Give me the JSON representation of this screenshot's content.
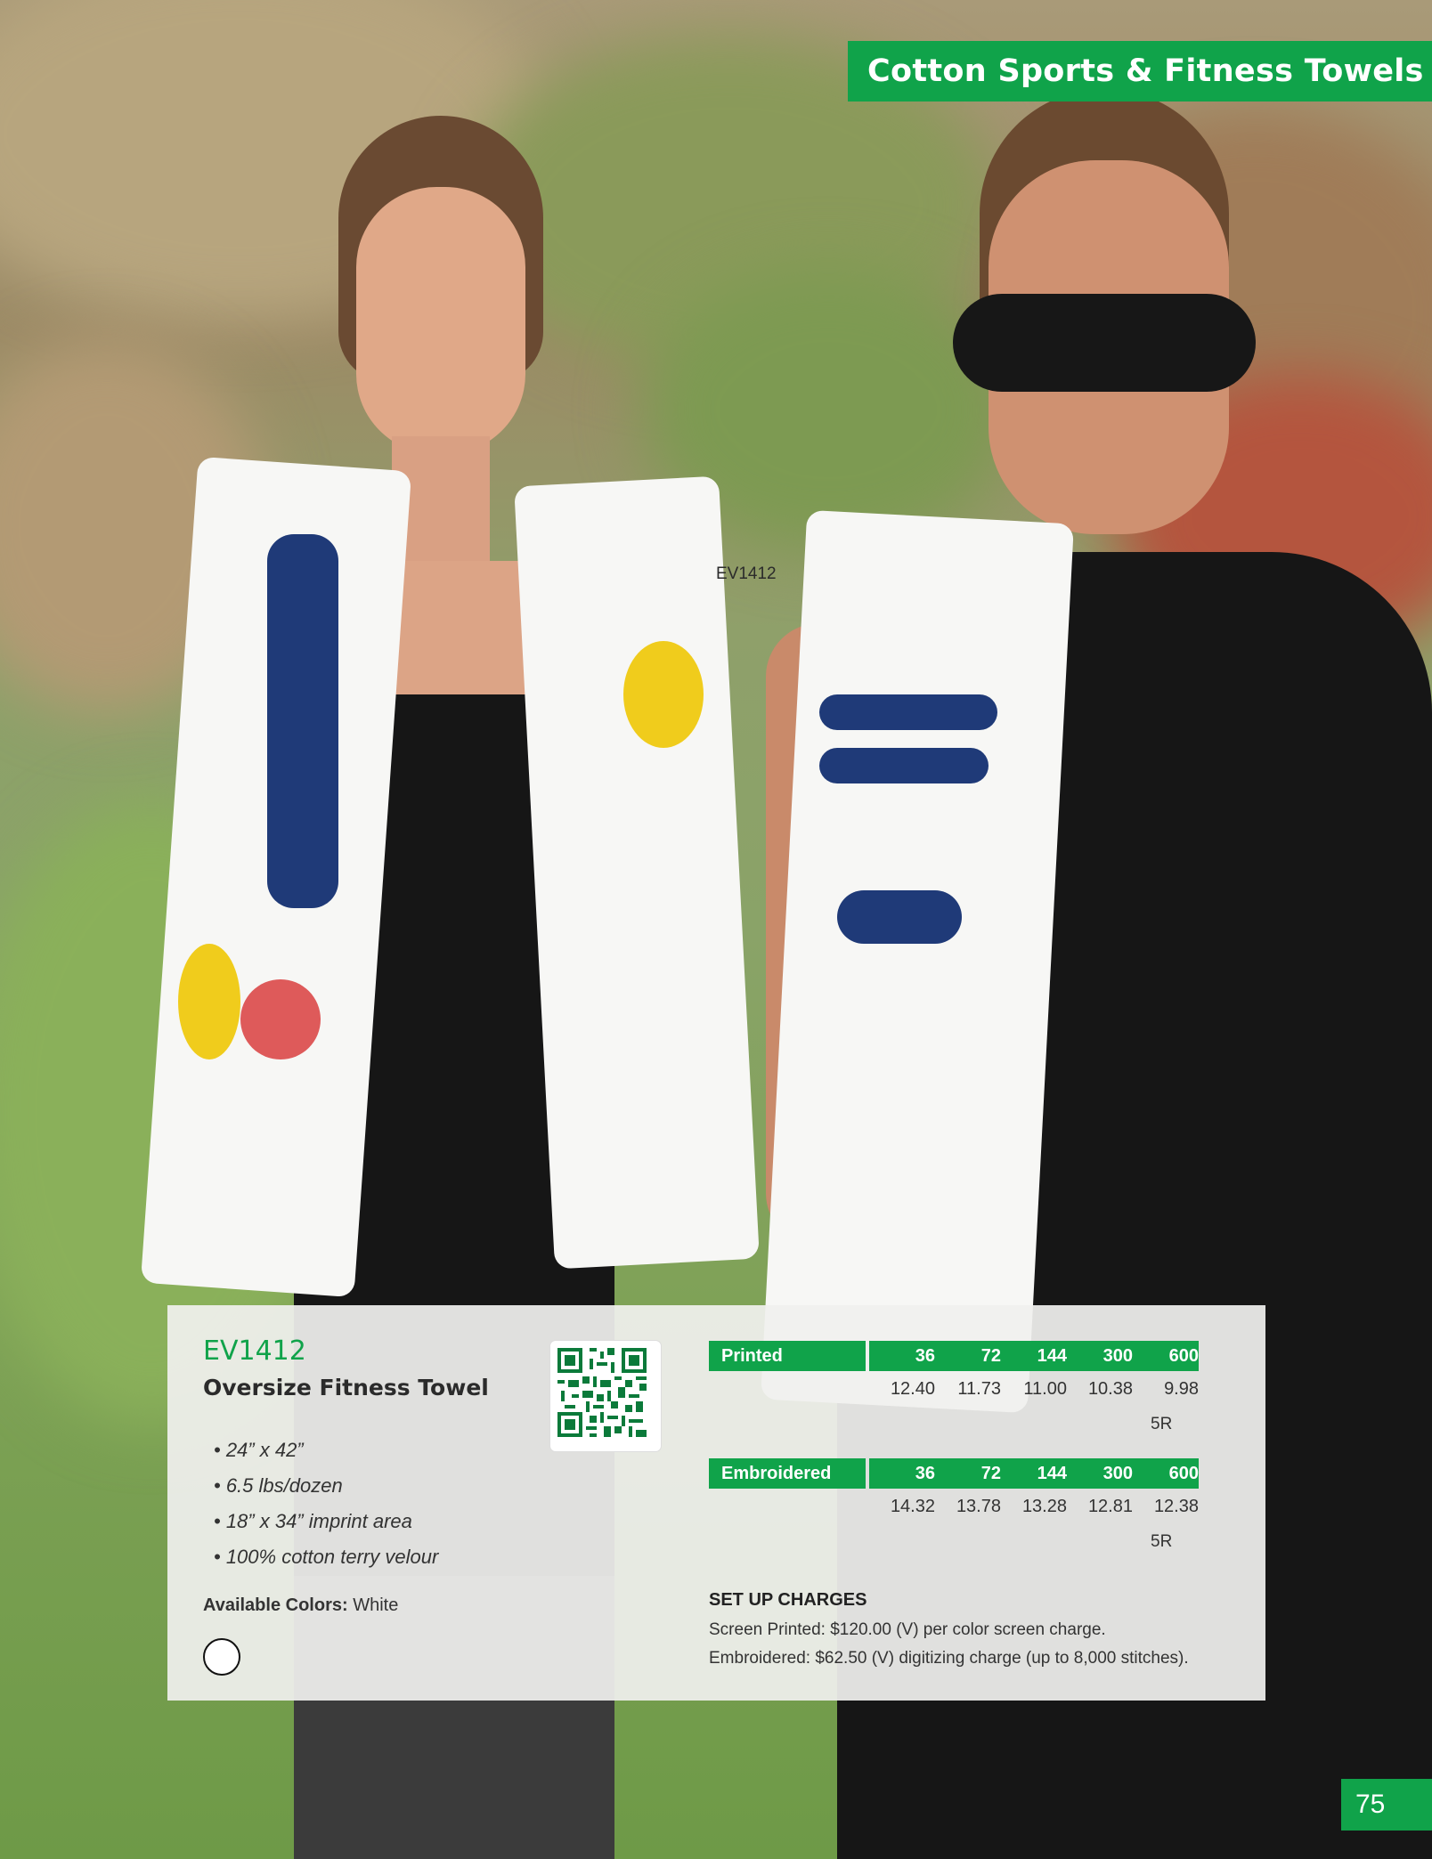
{
  "header": {
    "title": "Cotton Sports & Fitness Towels"
  },
  "photo": {
    "product_label": "EV1412"
  },
  "product": {
    "code": "EV1412",
    "name": "Oversize Fitness Towel",
    "features": [
      "• 24” x 42”",
      "• 6.5 lbs/dozen",
      "• 18” x 34” imprint area",
      "• 100% cotton terry velour"
    ],
    "colors_label": "Available Colors:",
    "colors_value": "White",
    "swatch_color": "#ffffff"
  },
  "pricing": {
    "printed": {
      "label": "Printed",
      "quantities": [
        "36",
        "72",
        "144",
        "300",
        "600"
      ],
      "prices": [
        "12.40",
        "11.73",
        "11.00",
        "10.38",
        "9.98"
      ],
      "code": "5R"
    },
    "embroidered": {
      "label": "Embroidered",
      "quantities": [
        "36",
        "72",
        "144",
        "300",
        "600"
      ],
      "prices": [
        "14.32",
        "13.78",
        "13.28",
        "12.81",
        "12.38"
      ],
      "code": "5R"
    }
  },
  "setup": {
    "title": "SET UP CHARGES",
    "lines": [
      "Screen Printed: $120.00 (V) per color screen charge.",
      "Embroidered: $62.50 (V) digitizing charge (up to 8,000 stitches)."
    ]
  },
  "page_number": "75",
  "colors": {
    "accent_green": "#10a34a"
  }
}
